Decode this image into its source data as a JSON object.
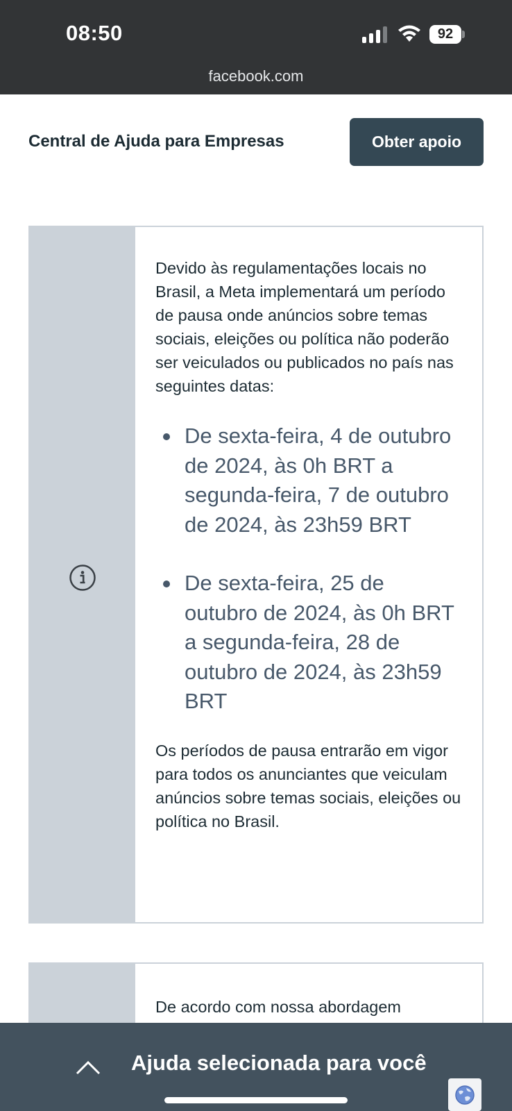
{
  "status_bar": {
    "time": "08:50",
    "battery": "92",
    "icons": [
      "signal-icon",
      "wifi-icon",
      "battery-icon"
    ]
  },
  "browser": {
    "url": "facebook.com"
  },
  "header": {
    "title": "Central de Ajuda para Empresas",
    "support_button": "Obter apoio"
  },
  "notice": {
    "intro": "Devido às regulamentações locais no Brasil, a Meta implementará um período de pausa onde anúncios sobre temas sociais, eleições ou política não poderão ser veiculados ou publicados no país nas seguintes datas:",
    "periods": [
      "De sexta-feira, 4 de outubro de 2024, às 0h BRT a segunda-feira, 7 de outubro de 2024, às 23h59 BRT",
      "De sexta-feira, 25 de outubro de 2024, às 0h BRT a segunda-feira, 28 de outubro de 2024, às 23h59 BRT"
    ],
    "outro": "Os períodos de pausa entrarão em vigor para todos os anunciantes que veiculam anúncios sobre temas sociais, eleições ou política no Brasil."
  },
  "second_notice": {
    "intro_partial": "De acordo com nossa abordagem"
  },
  "bottom_sheet": {
    "title": "Ajuda selecionada para você"
  },
  "colors": {
    "top_bar": "#323436",
    "button": "#344854",
    "card_side": "#cbd2d9",
    "bottom_sheet": "#43525e",
    "bullet_text": "#47586a"
  }
}
